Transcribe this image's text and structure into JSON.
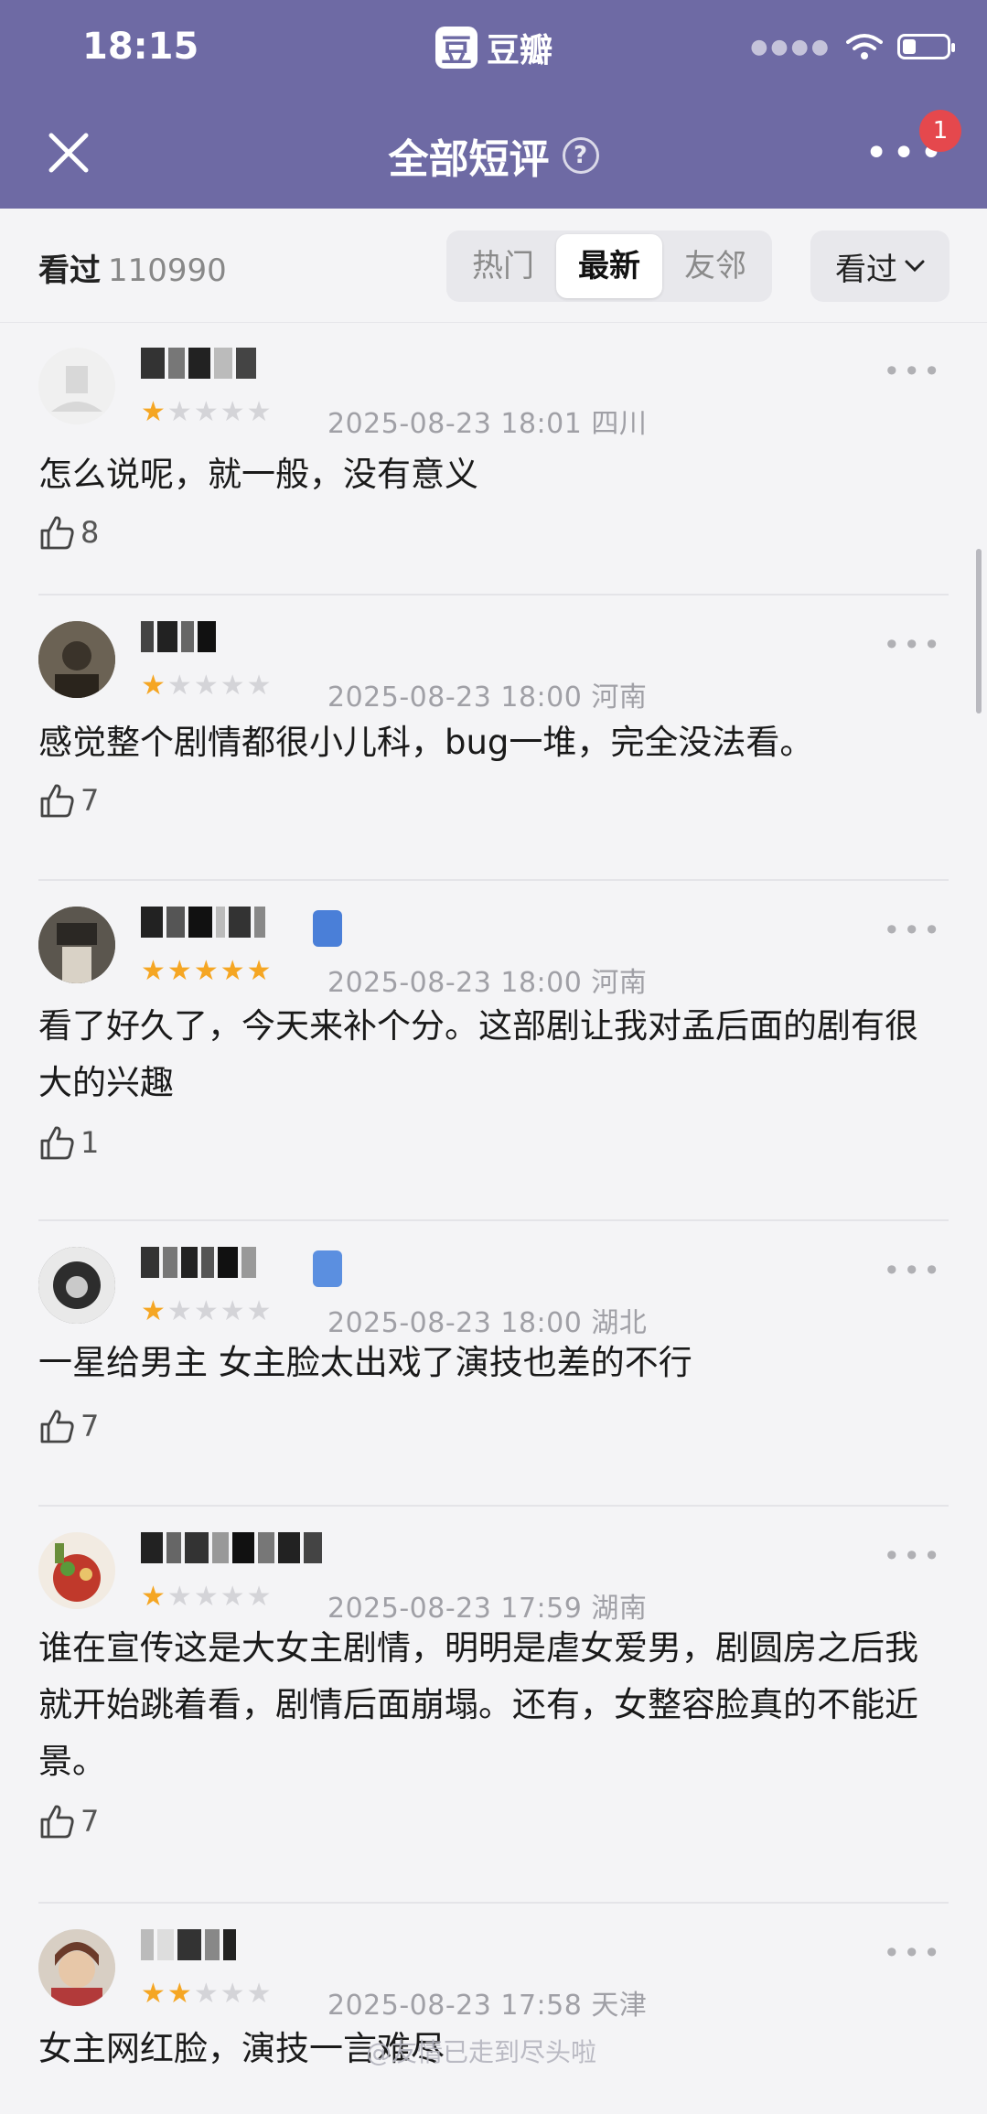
{
  "status": {
    "time": "18:15",
    "app_logo": "豆",
    "app_name": "豆瓣"
  },
  "nav": {
    "title": "全部短评",
    "help": "?",
    "badge": "1"
  },
  "filter": {
    "seen_label": "看过",
    "seen_count": "110990",
    "tabs": [
      "热门",
      "最新",
      "友邻"
    ],
    "active_tab": "最新",
    "dropdown": "看过"
  },
  "comments": [
    {
      "stars": 1,
      "date": "2025-08-23 18:01",
      "location": "四川",
      "text": "怎么说呢，就一般，没有意义",
      "likes": "8"
    },
    {
      "stars": 1,
      "date": "2025-08-23 18:00",
      "location": "河南",
      "text": "感觉整个剧情都很小儿科，bug一堆，完全没法看。",
      "likes": "7"
    },
    {
      "stars": 5,
      "date": "2025-08-23 18:00",
      "location": "河南",
      "text": "看了好久了，今天来补个分。这部剧让我对孟后面的剧有很大的兴趣",
      "likes": "1"
    },
    {
      "stars": 1,
      "date": "2025-08-23 18:00",
      "location": "湖北",
      "text": "一星给男主  女主脸太出戏了演技也差的不行",
      "likes": "7"
    },
    {
      "stars": 1,
      "date": "2025-08-23 17:59",
      "location": "湖南",
      "text": "谁在宣传这是大女主剧情，明明是虐女爱男，剧圆房之后我就开始跳着看，剧情后面崩塌。还有，女整容脸真的不能近景。",
      "likes": "7"
    },
    {
      "stars": 2,
      "date": "2025-08-23 17:58",
      "location": "天津",
      "text": "女主网红脸，演技一言难尽",
      "likes": ""
    }
  ],
  "watermark": "@友情已走到尽头啦",
  "colors": {
    "header": "#6e6aa4",
    "star": "#f5a623",
    "badge": "#e5484d"
  }
}
